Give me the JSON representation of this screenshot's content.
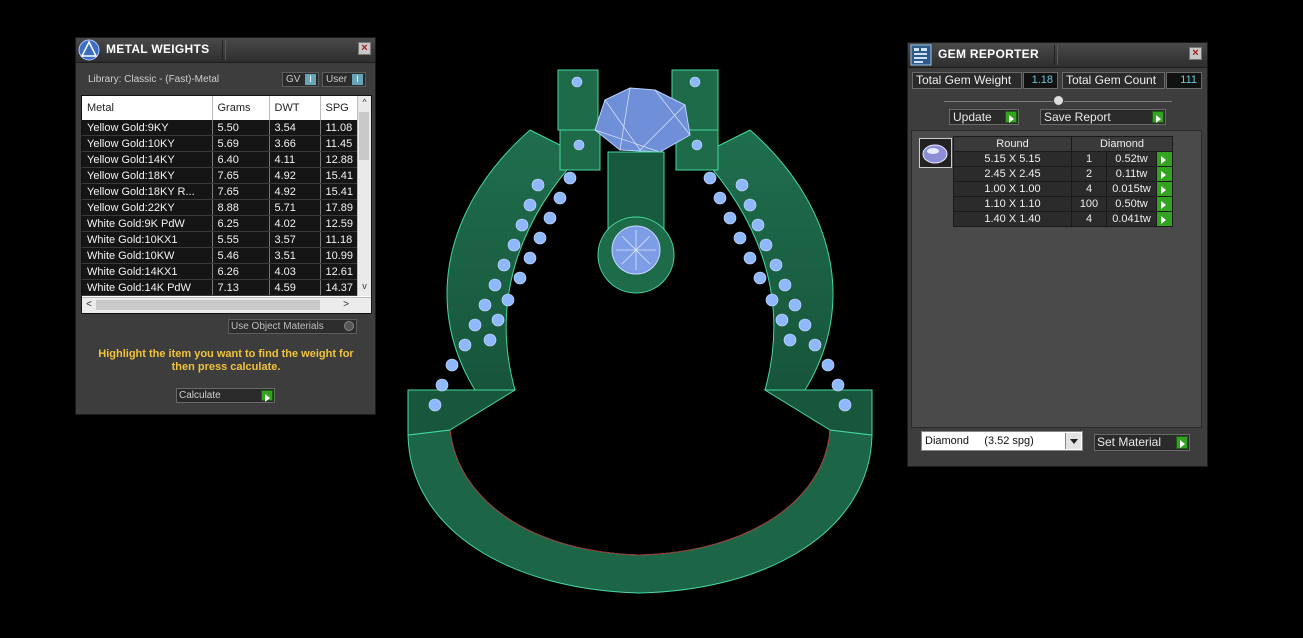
{
  "metal_weights": {
    "title": "METAL WEIGHTS",
    "library": "Library: Classic - (Fast)-Metal",
    "toggle_gv": "GV",
    "toggle_user": "User",
    "toggle_indicator": "I",
    "columns": [
      "Metal",
      "Grams",
      "DWT",
      "SPG"
    ],
    "rows": [
      [
        "Yellow Gold:9KY",
        "5.50",
        "3.54",
        "11.08"
      ],
      [
        "Yellow Gold:10KY",
        "5.69",
        "3.66",
        "11.45"
      ],
      [
        "Yellow Gold:14KY",
        "6.40",
        "4.11",
        "12.88"
      ],
      [
        "Yellow Gold:18KY",
        "7.65",
        "4.92",
        "15.41"
      ],
      [
        "Yellow Gold:18KY R...",
        "7.65",
        "4.92",
        "15.41"
      ],
      [
        "Yellow Gold:22KY",
        "8.88",
        "5.71",
        "17.89"
      ],
      [
        "White Gold:9K PdW",
        "6.25",
        "4.02",
        "12.59"
      ],
      [
        "White Gold:10KX1",
        "5.55",
        "3.57",
        "11.18"
      ],
      [
        "White Gold:10KW",
        "5.46",
        "3.51",
        "10.99"
      ],
      [
        "White Gold:14KX1",
        "6.26",
        "4.03",
        "12.61"
      ],
      [
        "White Gold:14K PdW",
        "7.13",
        "4.59",
        "14.37"
      ]
    ],
    "use_object_materials": "Use Object Materials",
    "instruction": "Highlight the item you want to find the weight for then press calculate.",
    "calculate_label": "Calculate"
  },
  "gem_reporter": {
    "title": "GEM REPORTER",
    "total_weight_label": "Total Gem Weight",
    "total_weight_value": "1.18",
    "total_count_label": "Total Gem Count",
    "total_count_value": "111",
    "update_label": "Update",
    "save_report_label": "Save Report",
    "columns": [
      "Round",
      "Diamond"
    ],
    "rows": [
      [
        "5.15 X 5.15",
        "1",
        "0.52tw"
      ],
      [
        "2.45 X 2.45",
        "2",
        "0.11tw"
      ],
      [
        "1.00 X 1.00",
        "4",
        "0.015tw"
      ],
      [
        "1.10 X 1.10",
        "100",
        "0.50tw"
      ],
      [
        "1.40 X 1.40",
        "4",
        "0.041tw"
      ]
    ],
    "material_select": "Diamond     (3.52 spg)",
    "set_material_label": "Set Material"
  },
  "colors": {
    "metal_green": "#1f6b4c",
    "gem_blue": "#8fb8ff",
    "highlight_yellow": "#f0c23a",
    "accent_green": "#34a321"
  }
}
